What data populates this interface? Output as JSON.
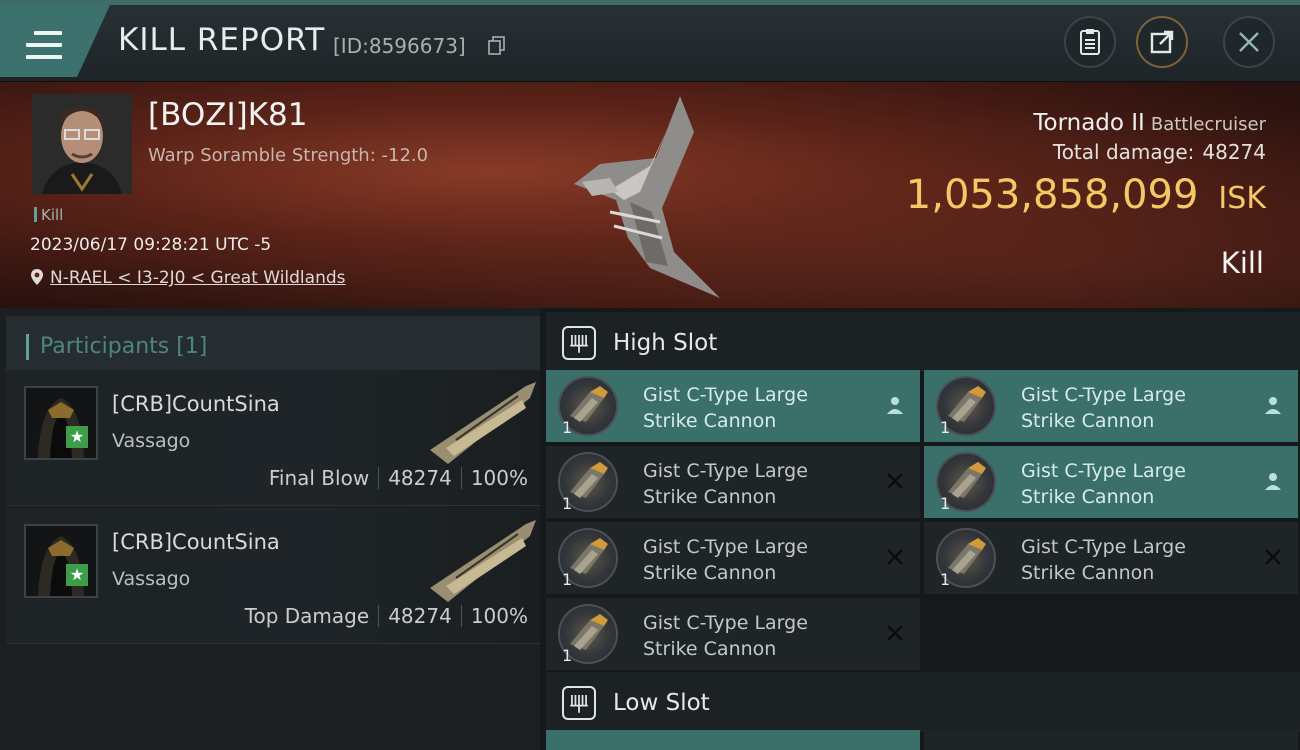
{
  "header": {
    "title": "KILL REPORT",
    "report_id": "[ID:8596673]"
  },
  "victim": {
    "pilot": "[BOZI]K81",
    "warp_scramble": "Warp Soramble Strength: -12.0",
    "tag": "Kill",
    "datetime": "2023/06/17 09:28:21 UTC -5",
    "location": "N-RAEL < I3-2J0 < Great Wildlands",
    "ship_name": "Tornado II",
    "ship_class": "Battlecruiser",
    "total_damage_label": "Total damage:",
    "total_damage": "48274",
    "isk_value": "1,053,858,099",
    "isk_unit": "ISK",
    "result": "Kill"
  },
  "participants": {
    "label": "Participants [1]",
    "items": [
      {
        "name": "[CRB]CountSina",
        "ship": "Vassago",
        "role": "Final Blow",
        "damage": "48274",
        "percent": "100%"
      },
      {
        "name": "[CRB]CountSina",
        "ship": "Vassago",
        "role": "Top Damage",
        "damage": "48274",
        "percent": "100%"
      }
    ]
  },
  "slots": {
    "high": {
      "label": "High Slot",
      "modules": [
        {
          "name": "Gist C-Type Large Strike Cannon",
          "qty": "1",
          "state": "fitted"
        },
        {
          "name": "Gist C-Type Large Strike Cannon",
          "qty": "1",
          "state": "fitted"
        },
        {
          "name": "Gist C-Type Large Strike Cannon",
          "qty": "1",
          "state": "destroyed"
        },
        {
          "name": "Gist C-Type Large Strike Cannon",
          "qty": "1",
          "state": "fitted"
        },
        {
          "name": "Gist C-Type Large Strike Cannon",
          "qty": "1",
          "state": "destroyed"
        },
        {
          "name": "Gist C-Type Large Strike Cannon",
          "qty": "1",
          "state": "destroyed"
        },
        {
          "name": "Gist C-Type Large Strike Cannon",
          "qty": "1",
          "state": "destroyed"
        }
      ]
    },
    "low": {
      "label": "Low Slot"
    }
  },
  "colors": {
    "accent": "#3b6f6a",
    "isk": "#f6c765",
    "star": "#3d9e49"
  }
}
